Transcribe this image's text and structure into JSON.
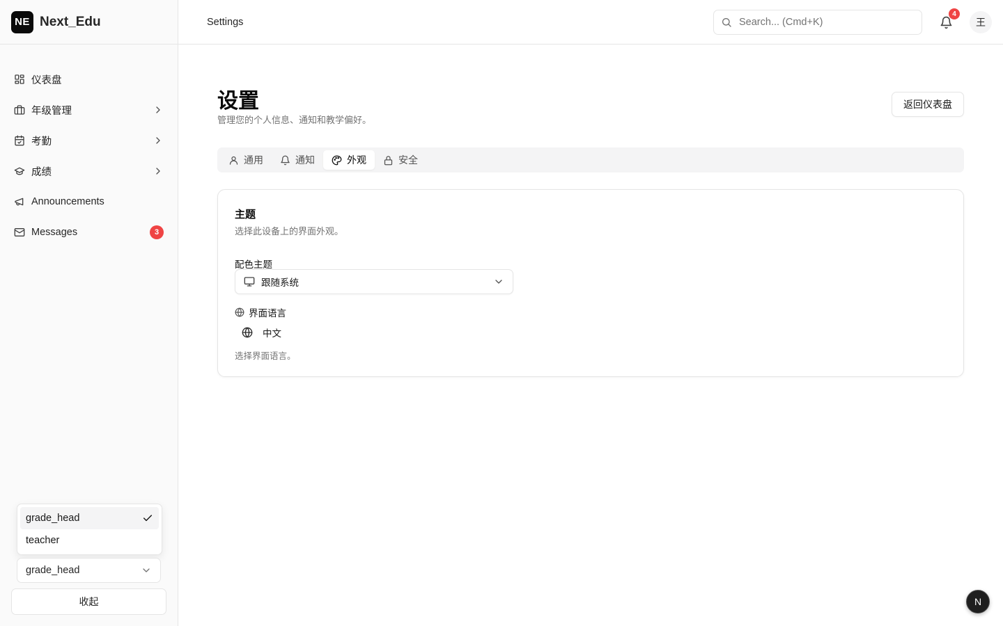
{
  "brand": {
    "logo_text": "NE",
    "name": "Next_Edu"
  },
  "sidebar": {
    "items": [
      {
        "label": "仪表盘",
        "icon": "dashboard-grid-icon"
      },
      {
        "label": "年级管理",
        "icon": "briefcase-icon",
        "has_submenu": true
      },
      {
        "label": "考勤",
        "icon": "calendar-check-icon",
        "has_submenu": true
      },
      {
        "label": "成绩",
        "icon": "graduation-cap-icon",
        "has_submenu": true
      },
      {
        "label": "Announcements",
        "icon": "megaphone-icon"
      },
      {
        "label": "Messages",
        "icon": "mail-icon",
        "badge": "3"
      }
    ],
    "role_menu": {
      "options": [
        "grade_head",
        "teacher"
      ],
      "selected": "grade_head"
    },
    "role_select": {
      "value": "grade_head"
    },
    "collapse_label": "收起"
  },
  "header": {
    "breadcrumb": "Settings",
    "search": {
      "placeholder": "Search... (Cmd+K)",
      "value": ""
    },
    "notifications_count": "4",
    "avatar_text": "王"
  },
  "main": {
    "title": "设置",
    "description": "管理您的个人信息、通知和教学偏好。",
    "back_button": "返回仪表盘",
    "tabs": [
      {
        "label": "通用",
        "icon": "user-icon"
      },
      {
        "label": "通知",
        "icon": "bell-icon"
      },
      {
        "label": "外观",
        "icon": "palette-icon",
        "active": true
      },
      {
        "label": "安全",
        "icon": "lock-icon"
      }
    ],
    "card": {
      "title": "主题",
      "description": "选择此设备上的界面外观。",
      "color_theme_label": "配色主题",
      "color_theme_value": "跟随系统",
      "language_label": "界面语言",
      "language_value": "中文",
      "language_hint": "选择界面语言。"
    }
  },
  "fab_text": "N",
  "colors": {
    "accent": "#0a0a0a",
    "badge": "#ef4444",
    "sidebar_bg": "#fafafa",
    "border": "#e5e5e5"
  }
}
